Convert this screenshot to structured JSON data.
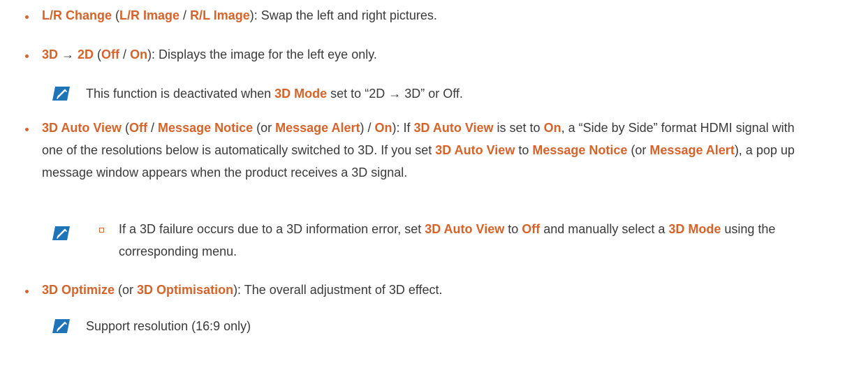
{
  "colors": {
    "accent": "#d5632a",
    "text": "#3a3a3a"
  },
  "items": [
    {
      "parts": [
        "L/R Change",
        " (",
        "L/R Image",
        " / ",
        "R/L Image",
        "): Swap the left and right pictures."
      ]
    },
    {
      "parts": [
        "3D",
        " → ",
        "2D",
        " (",
        "Off",
        " / ",
        "On",
        "): Displays the image for the left eye only."
      ]
    },
    {
      "parts": [
        "3D Auto View",
        " (",
        "Off",
        " / ",
        "Message Notice",
        " (or ",
        "Message Alert",
        ") / ",
        "On",
        "): If ",
        "3D Auto View",
        " is set to ",
        "On",
        ", a “Side by Side” format HDMI signal with one of the resolutions below is automatically switched to 3D. If you set ",
        "3D Auto View",
        " to ",
        "Message Notice",
        " (or ",
        "Message Alert",
        "), a pop up message window appears when the product receives a 3D signal."
      ]
    },
    {
      "parts": [
        "3D Optimize",
        " (or ",
        "3D Optimisation",
        "): The overall adjustment of 3D effect."
      ]
    }
  ],
  "notes": [
    {
      "icon": "note-pencil-icon",
      "parts": [
        "This function is deactivated when ",
        "3D Mode",
        " set to “2D → 3D” or Off."
      ]
    },
    {
      "icon": "note-pencil-icon",
      "parts": [
        "If a 3D failure occurs due to a 3D information error, set ",
        "3D Auto View",
        " to ",
        "Off",
        " and manually select a ",
        "3D Mode",
        " using the corresponding menu."
      ]
    },
    {
      "icon": "note-pencil-icon",
      "parts": [
        "Support resolution (16:9 only)"
      ]
    }
  ]
}
